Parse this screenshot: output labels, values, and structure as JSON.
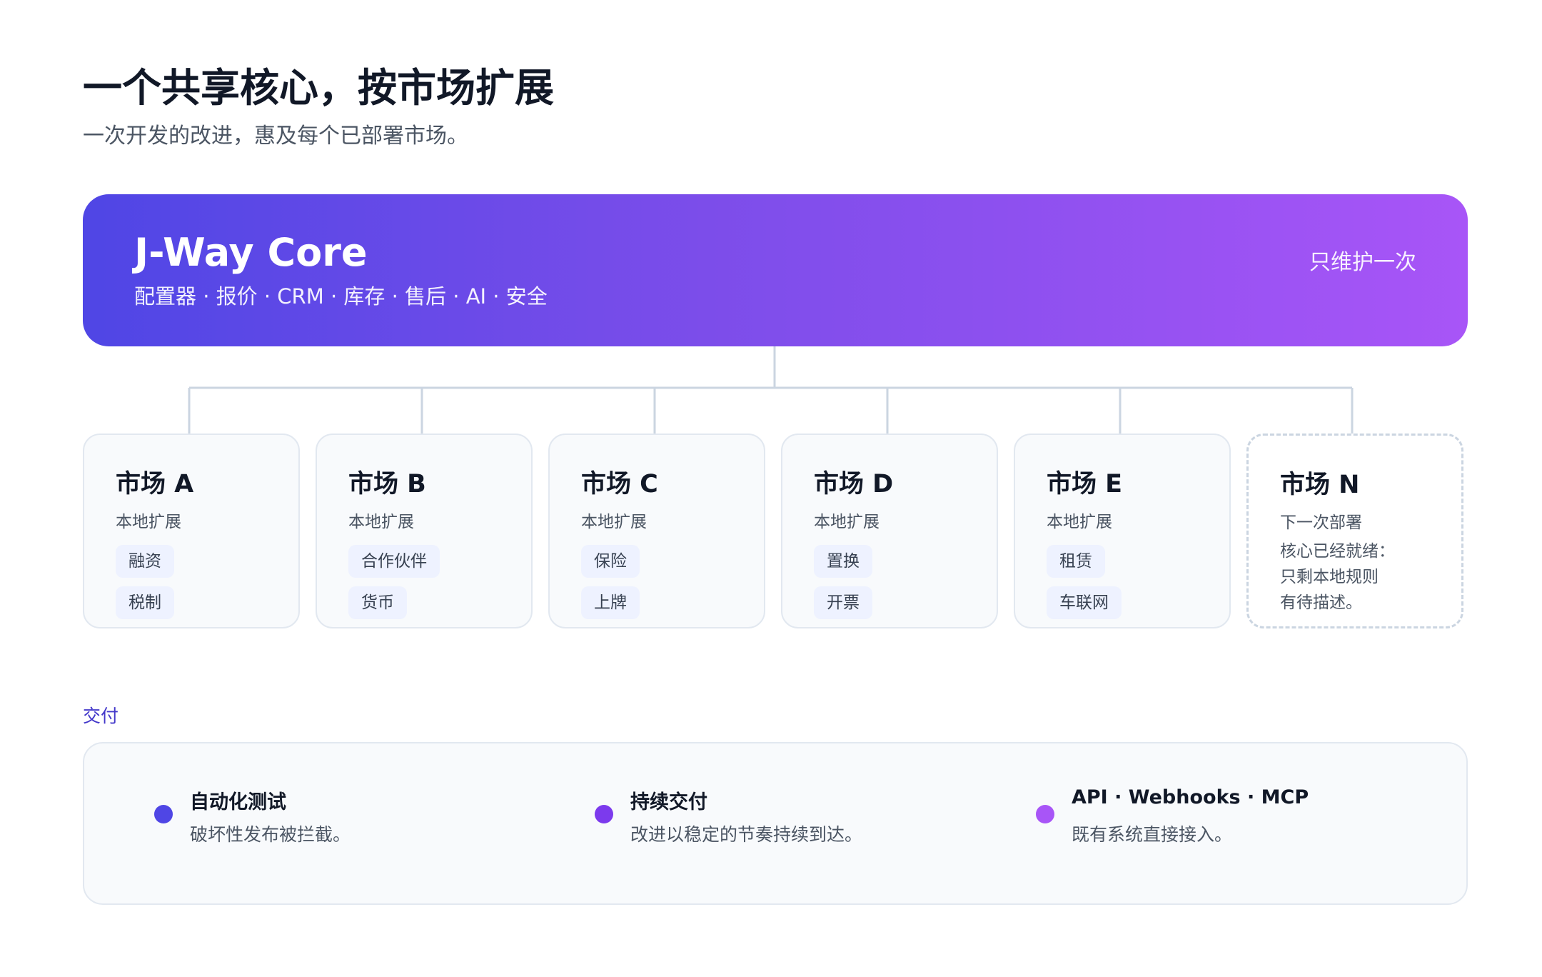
{
  "header": {
    "title": "一个共享核心，按市场扩展",
    "subtitle": "一次开发的改进，惠及每个已部署市场。"
  },
  "core": {
    "title": "J-Way Core",
    "modules": "配置器 · 报价 · CRM · 库存 · 售后 · AI · 安全",
    "note": "只维护一次"
  },
  "colors": {
    "accent_start": "#4f46e5",
    "accent_end": "#a855f7",
    "dot_1": "#4f46e5",
    "dot_2": "#7c3aed",
    "dot_3": "#a855f7"
  },
  "markets": [
    {
      "title": "市场 A",
      "subtitle": "本地扩展",
      "tags": [
        "融资",
        "税制"
      ]
    },
    {
      "title": "市场 B",
      "subtitle": "本地扩展",
      "tags": [
        "合作伙伴",
        "货币"
      ]
    },
    {
      "title": "市场 C",
      "subtitle": "本地扩展",
      "tags": [
        "保险",
        "上牌"
      ]
    },
    {
      "title": "市场 D",
      "subtitle": "本地扩展",
      "tags": [
        "置换",
        "开票"
      ]
    },
    {
      "title": "市场 E",
      "subtitle": "本地扩展",
      "tags": [
        "租赁",
        "车联网"
      ]
    },
    {
      "title": "市场 N",
      "subtitle": "下一次部署",
      "note": [
        "核心已经就绪：",
        "只剩本地规则",
        "有待描述。"
      ]
    }
  ],
  "delivery": {
    "label": "交付",
    "items": [
      {
        "title": "自动化测试",
        "desc": "破坏性发布被拦截。"
      },
      {
        "title": "持续交付",
        "desc": "改进以稳定的节奏持续到达。"
      },
      {
        "title": "API · Webhooks · MCP",
        "desc": "既有系统直接接入。"
      }
    ]
  }
}
